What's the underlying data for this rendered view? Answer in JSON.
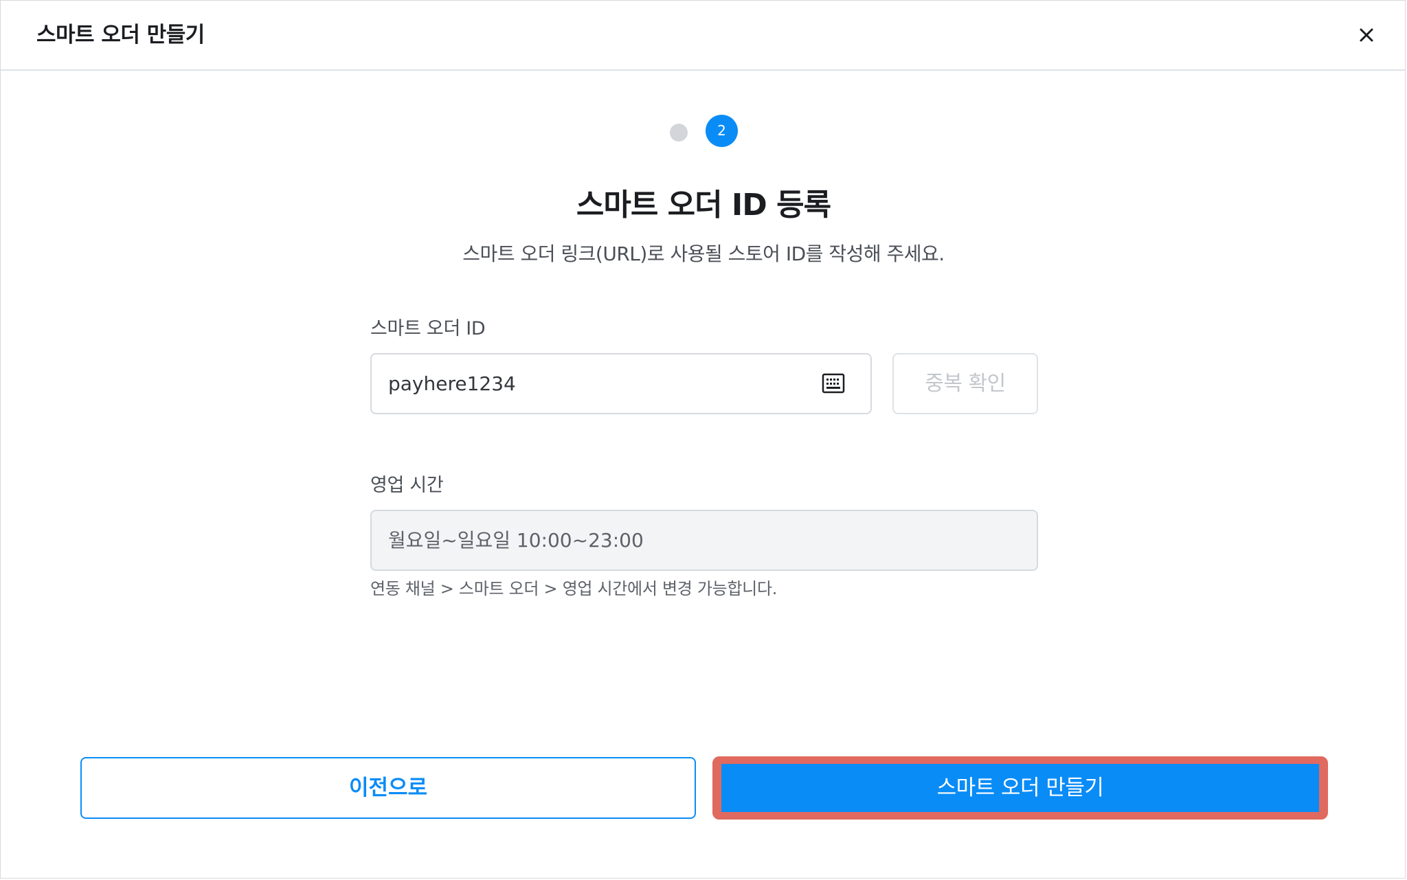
{
  "header": {
    "title": "스마트 오더 만들기",
    "close_icon": "close-icon"
  },
  "stepper": {
    "current_step": "2",
    "total_steps": 2
  },
  "main": {
    "title": "스마트 오더 ID 등록",
    "subtitle": "스마트 오더 링크(URL)로 사용될 스토어 ID를 작성해 주세요."
  },
  "id_field": {
    "label": "스마트 오더 ID",
    "value": "payhere1234",
    "icon": "keyboard-icon",
    "duplicate_check_label": "중복 확인"
  },
  "hours_field": {
    "label": "영업 시간",
    "value": "월요일~일요일 10:00~23:00",
    "helper": "연동 채널 > 스마트 오더 > 영업 시간에서 변경 가능합니다."
  },
  "footer": {
    "prev_label": "이전으로",
    "create_label": "스마트 오더 만들기"
  },
  "colors": {
    "accent": "#0a8cf7",
    "highlight": "#e06a5f",
    "inactive_step": "#d2d5da"
  }
}
